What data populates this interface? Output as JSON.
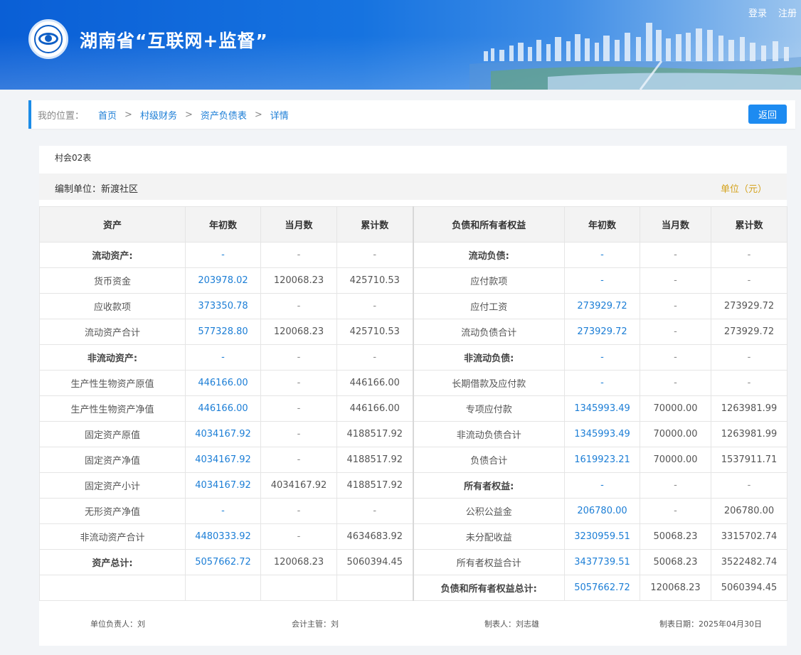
{
  "header": {
    "title": "湖南省“互联网+监督”",
    "login": "登录",
    "register": "注册"
  },
  "breadcrumb": {
    "label": "我的位置：",
    "items": [
      "首页",
      "村级财务",
      "资产负债表",
      "详情"
    ],
    "separator": ">",
    "back": "返回"
  },
  "report": {
    "form_code": "村会02表",
    "org": "编制单位：新渡社区",
    "currency": "单位（元）",
    "columns": [
      "资产",
      "年初数",
      "当月数",
      "累计数",
      "负债和所有者权益",
      "年初数",
      "当月数",
      "累计数"
    ],
    "rows": [
      [
        "流动资产:",
        "-",
        "-",
        "-",
        "流动负债:",
        "-",
        "-",
        "-"
      ],
      [
        "货币资金",
        "203978.02",
        "120068.23",
        "425710.53",
        "应付款项",
        "-",
        "-",
        "-"
      ],
      [
        "应收款项",
        "373350.78",
        "-",
        "-",
        "应付工资",
        "273929.72",
        "-",
        "273929.72"
      ],
      [
        "流动资产合计",
        "577328.80",
        "120068.23",
        "425710.53",
        "流动负债合计",
        "273929.72",
        "-",
        "273929.72"
      ],
      [
        "非流动资产:",
        "-",
        "-",
        "-",
        "非流动负债:",
        "-",
        "-",
        "-"
      ],
      [
        "生产性生物资产原值",
        "446166.00",
        "-",
        "446166.00",
        "长期借款及应付款",
        "-",
        "-",
        "-"
      ],
      [
        "生产性生物资产净值",
        "446166.00",
        "-",
        "446166.00",
        "专项应付款",
        "1345993.49",
        "70000.00",
        "1263981.99"
      ],
      [
        "固定资产原值",
        "4034167.92",
        "-",
        "4188517.92",
        "非流动负债合计",
        "1345993.49",
        "70000.00",
        "1263981.99"
      ],
      [
        "固定资产净值",
        "4034167.92",
        "-",
        "4188517.92",
        "负债合计",
        "1619923.21",
        "70000.00",
        "1537911.71"
      ],
      [
        "固定资产小计",
        "4034167.92",
        "4034167.92",
        "4188517.92",
        "所有者权益:",
        "-",
        "-",
        "-"
      ],
      [
        "无形资产净值",
        "-",
        "-",
        "-",
        "公积公益金",
        "206780.00",
        "-",
        "206780.00"
      ],
      [
        "非流动资产合计",
        "4480333.92",
        "-",
        "4634683.92",
        "未分配收益",
        "3230959.51",
        "50068.23",
        "3315702.74"
      ],
      [
        "资产总计:",
        "5057662.72",
        "120068.23",
        "5060394.45",
        "所有者权益合计",
        "3437739.51",
        "50068.23",
        "3522482.74"
      ],
      [
        "",
        "",
        "",
        "",
        "负债和所有者权益总计:",
        "5057662.72",
        "120068.23",
        "5060394.45"
      ]
    ],
    "bold_left_rows": [
      0,
      4,
      12
    ],
    "bold_right_rows": [
      0,
      4,
      9,
      13
    ]
  },
  "footer": {
    "unit_head": "单位负责人：刘",
    "accountant": "会计主管：刘",
    "preparer": "制表人：刘志雄",
    "date": "制表日期：2025年04月30日"
  },
  "colors": {
    "accent": "#1d8bf1",
    "link": "#1c7ed6",
    "currency": "#d4a21b"
  }
}
